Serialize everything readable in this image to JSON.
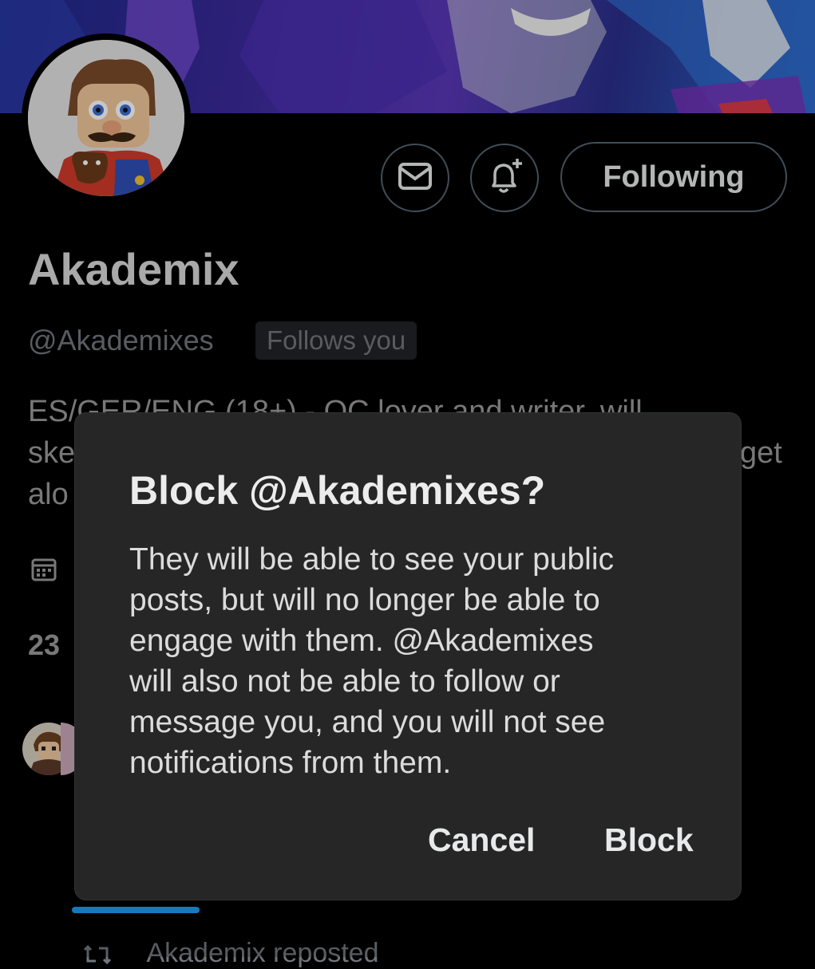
{
  "profile": {
    "name": "Akademix",
    "handle": "@Akademixes",
    "follows_badge": "Follows you",
    "following_button": "Following",
    "bio_lines": [
      "ES/GER/ENG (18+) - OC lover and writer, will",
      "ske",
      "alo"
    ],
    "bio_line2_tail": "get",
    "count_visible": "23"
  },
  "icons": {
    "message": "envelope-icon",
    "notifications": "bell-plus-icon",
    "joined": "calendar-icon",
    "repost": "repost-icon"
  },
  "dialog": {
    "title": "Block @Akademixes?",
    "body_lines": [
      "They will be able to see your public",
      "posts, but will no longer be able to",
      "engage with them. @Akademixes",
      "will also not be able to follow or",
      "message you, and you will not see",
      "notifications from them."
    ],
    "cancel_label": "Cancel",
    "confirm_label": "Block"
  },
  "feed": {
    "repost_text": "Akademix reposted"
  },
  "colors": {
    "background": "#000000",
    "dialog_background": "#262626",
    "accent": "#1d9bf0",
    "border": "#536471",
    "secondary_text": "#71767b"
  }
}
